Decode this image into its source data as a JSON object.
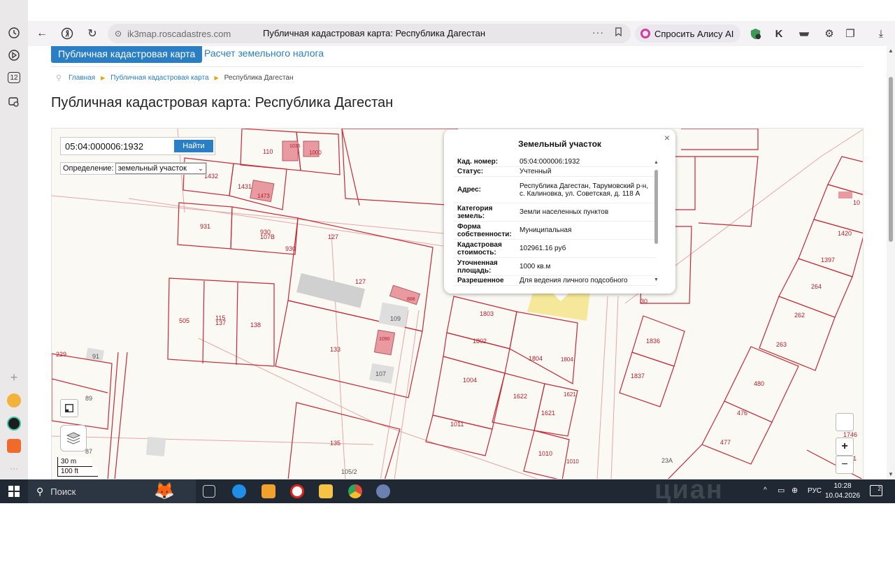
{
  "browser": {
    "host": "ik3map.roscadastres.com",
    "title": "Публичная кадастровая карта: Республика Дагестан",
    "alice_label": "Спросить Алису AI",
    "more_glyph": "···"
  },
  "sidebar": {
    "tab_count_label": "12"
  },
  "nav": {
    "active_label": "Публичная кадастровая карта",
    "tax_label": "Расчет земельного налога"
  },
  "breadcrumb": {
    "home": "Главная",
    "map": "Публичная кадастровая карта",
    "current": "Республика Дагестан"
  },
  "page_title": "Публичная кадастровая карта: Республика Дагестан",
  "search": {
    "value": "05:04:000006:1932",
    "button": "Найти",
    "definition_label": "Определение:",
    "definition_value": "земельный участок"
  },
  "scale": {
    "metric": "30 m",
    "imperial": "100 ft"
  },
  "zoom": {
    "in": "+",
    "out": "−"
  },
  "popup": {
    "title": "Земельный участок",
    "close": "×",
    "rows": [
      {
        "key": "Кад. номер:",
        "value": "05:04:000006:1932"
      },
      {
        "key": "Статус:",
        "value": "Учтенный"
      },
      {
        "key": "Адрес:",
        "value": "Республика Дагестан, Тарумовский р-н, с. Калиновка, ул. Советская, д. 118 А"
      },
      {
        "key": "Категория земель:",
        "value": "Земли населенных пунктов"
      },
      {
        "key": "Форма собственности:",
        "value": "Муниципальная"
      },
      {
        "key": "Кадастровая стоимость:",
        "value": "102961.16 руб"
      },
      {
        "key": "Уточненная площадь:",
        "value": "1000 кв.м"
      },
      {
        "key": "Разрешенное",
        "value": "Для ведения личного подсобного"
      }
    ]
  },
  "parcels": [
    "110",
    "1035",
    "1000",
    "1432",
    "1431",
    "1473",
    "931",
    "930",
    "107В",
    "930",
    "127",
    "127",
    "888",
    "109",
    "505",
    "115",
    "137",
    "138",
    "133",
    "1090",
    "107",
    "229",
    "91",
    "89",
    "87",
    "135",
    "105/2",
    "1803",
    "1802",
    "1804",
    "1804",
    "1004",
    "1622",
    "1621",
    "1621",
    "1011",
    "1010",
    "1010",
    "30",
    "1836",
    "1837",
    "23А",
    "480",
    "476",
    "477",
    "263",
    "262",
    "264",
    "1397",
    "1420",
    "10",
    "1746",
    "1"
  ],
  "taskbar": {
    "search_label": "Поиск",
    "lang": "РУС",
    "time": "10:28",
    "date": "10.04.2026",
    "notif_count": "2",
    "watermark": "циан"
  }
}
